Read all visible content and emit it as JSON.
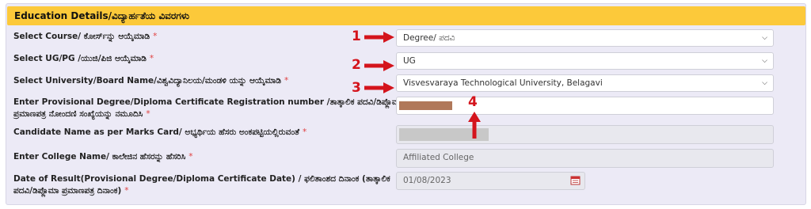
{
  "section": {
    "title": "Education Details/ವಿದ್ಯಾರ್ಹತೆಯ ವಿವರಗಳು"
  },
  "fields": {
    "course": {
      "label": "Select Course/ ಕೋರ್ಸ್‌ನ್ನು ಆಯ್ಕೆಮಾಡಿ",
      "value": "Degree/ ಪದವಿ"
    },
    "ugpg": {
      "label": "Select UG/PG /ಯುಜಿ/ಪಿಜಿ ಆಯ್ಕೆಮಾಡಿ",
      "value": "UG"
    },
    "university": {
      "label": "Select University/Board Name/ವಿಶ್ವವಿದ್ಯಾನಿಲಯ/ಮಂಡಳಿ ಯನ್ನು ಆಯ್ಕೆಮಾಡಿ",
      "value": "Visvesvaraya Technological University, Belagavi"
    },
    "registration": {
      "label_line1": "Enter Provisional Degree/Diploma Certificate Registration number /ತಾತ್ಕಾಲಿಕ ಪದವಿ/ಡಿಪ್ಲೊಮಾ",
      "label_line2": "ಪ್ರಮಾಣಪತ್ರ ನೋಂದಣಿ ಸಂಖ್ಯೆಯನ್ನು ನಮೂದಿಸಿ"
    },
    "candidate": {
      "label": "Candidate Name as per Marks Card/ ಅಭ್ಯರ್ಥಿಯ ಹೆಸರು ಅಂಕಪಟ್ಟಿಯಲ್ಲಿರುವಂತೆ"
    },
    "college": {
      "label": "Enter College Name/ ಕಾಲೇಜಿನ ಹೆಸರನ್ನು ಹೆಸರಿಸಿ",
      "value": "Affiliated College"
    },
    "result_date": {
      "label_line1": "Date of Result(Provisional Degree/Diploma Certificate Date) / ಫಲಿತಾಂಶದ ದಿನಾಂಕ (ತಾತ್ಕಾಲಿಕ",
      "label_line2": "ಪದವಿ/ಡಿಪ್ಲೊಮಾ ಪ್ರಮಾಣಪತ್ರ ದಿನಾಂಕ)",
      "value": "01/08/2023"
    },
    "required_mark": "*"
  },
  "annotations": {
    "n1": "1",
    "n2": "2",
    "n3": "3",
    "n4": "4",
    "color": "#d4141c"
  },
  "icons": {
    "chevron": "chevron-down-icon",
    "calendar": "calendar-icon"
  }
}
